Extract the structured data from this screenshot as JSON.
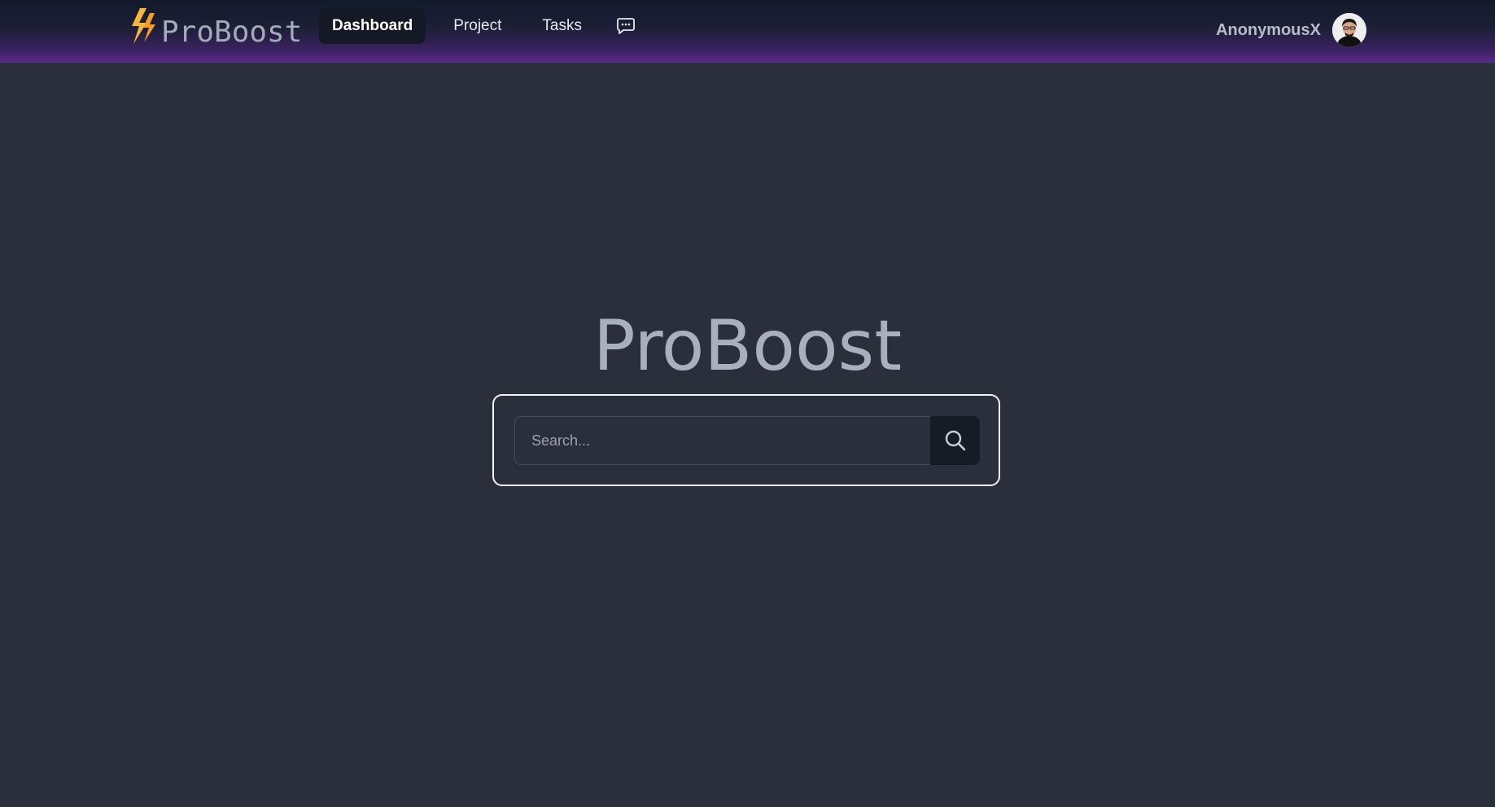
{
  "navbar": {
    "brand": "ProBoost",
    "links": [
      {
        "label": "Dashboard",
        "active": true
      },
      {
        "label": "Project",
        "active": false
      },
      {
        "label": "Tasks",
        "active": false
      }
    ],
    "chat_icon": "chat-bubble-icon",
    "user": {
      "name": "AnonymousX",
      "avatar_icon": "user-avatar"
    }
  },
  "hero": {
    "title": "ProBoost"
  },
  "search": {
    "value": "",
    "placeholder": "Search...",
    "button_icon": "search-icon"
  },
  "colors": {
    "background": "#2a2f3b",
    "nav_gradient_bottom": "#5b2a8c",
    "accent_bolt": "#f6b73c"
  }
}
